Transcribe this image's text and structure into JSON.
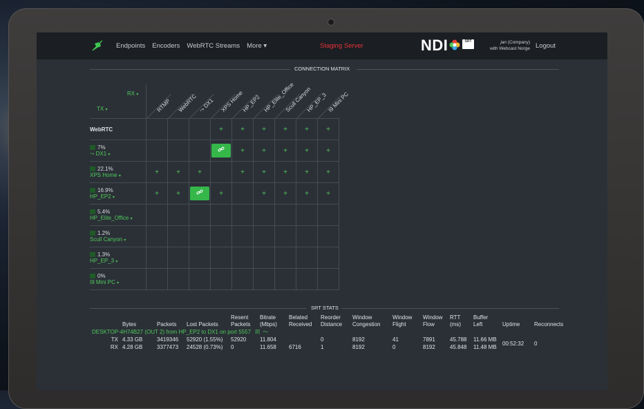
{
  "nav": {
    "items": [
      "Endpoints",
      "Encoders",
      "WebRTC Streams",
      "More ▾"
    ],
    "staging": "Staging Server",
    "ndi": "NDI",
    "srt_badge": "SRT",
    "user_name": "jan",
    "user_company": " (Company)",
    "user_line2": "with Webcast Norge",
    "logout": "Logout"
  },
  "matrix": {
    "title": "CONNECTION MATRIX",
    "rx_label": "RX",
    "tx_label": "TX",
    "caret": "▾",
    "columns": [
      "RTMP",
      "WebRTC",
      "⤳ DX1",
      "XPS Home",
      "HP_EP2",
      "HP_Elite_Office",
      "Scull Canyon",
      "HP_EP_3",
      "I9 Mini PC"
    ],
    "rows": [
      {
        "name": "WebRTC",
        "pct": "",
        "cells": [
          "",
          "",
          "",
          "+",
          "+",
          "+",
          "+",
          "+",
          "+"
        ]
      },
      {
        "name": "⤳ DX1",
        "pct": "7%",
        "cells": [
          "",
          "",
          "",
          "link",
          "+",
          "+",
          "+",
          "+",
          "+"
        ]
      },
      {
        "name": "XPS Home",
        "pct": "22.1%",
        "cells": [
          "+",
          "+",
          "+",
          "",
          "+",
          "+",
          "+",
          "+",
          "+"
        ]
      },
      {
        "name": "HP_EP2",
        "pct": "16.9%",
        "cells": [
          "+",
          "+",
          "link",
          "+",
          "",
          "+",
          "+",
          "+",
          "+"
        ]
      },
      {
        "name": "HP_Elite_Office",
        "pct": "5.4%",
        "cells": [
          "",
          "",
          "",
          "",
          "",
          "",
          "",
          "",
          ""
        ]
      },
      {
        "name": "Scull Canyon",
        "pct": "1.2%",
        "cells": [
          "",
          "",
          "",
          "",
          "",
          "",
          "",
          "",
          ""
        ]
      },
      {
        "name": "HP_EP_3",
        "pct": "1.3%",
        "cells": [
          "",
          "",
          "",
          "",
          "",
          "",
          "",
          "",
          ""
        ]
      },
      {
        "name": "I9 Mini PC",
        "pct": "0%",
        "cells": [
          "",
          "",
          "",
          "",
          "",
          "",
          "",
          "",
          ""
        ]
      }
    ]
  },
  "stats": {
    "title": "SRT STATS",
    "headers": [
      "",
      "Bytes",
      "Packets",
      "Lost Packets",
      "Resent Packets",
      "Bitrate (Mbps)",
      "Belated Received",
      "Reorder Distance",
      "Window Congestion",
      "Window Flight",
      "Window Flow",
      "RTT (ms)",
      "Buffer Left",
      "Uptime",
      "Reconnects"
    ],
    "connection": "DESKTOP-4H74B27 (OUT 2) from HP_EP2 to DX1 on port 5557",
    "rows": [
      [
        "TX",
        "4.33 GB",
        "3419346",
        "52920 (1.55%)",
        "52920",
        "11.804",
        "",
        "0",
        "8192",
        "41",
        "7891",
        "45.788",
        "11.66 MB"
      ],
      [
        "RX",
        "4.28 GB",
        "3377473",
        "24528 (0.73%)",
        "0",
        "11.658",
        "6716",
        "1",
        "8192",
        "0",
        "8192",
        "45.848",
        "11.48 MB"
      ]
    ],
    "uptime": "00:52:32",
    "reconnects": "0"
  }
}
